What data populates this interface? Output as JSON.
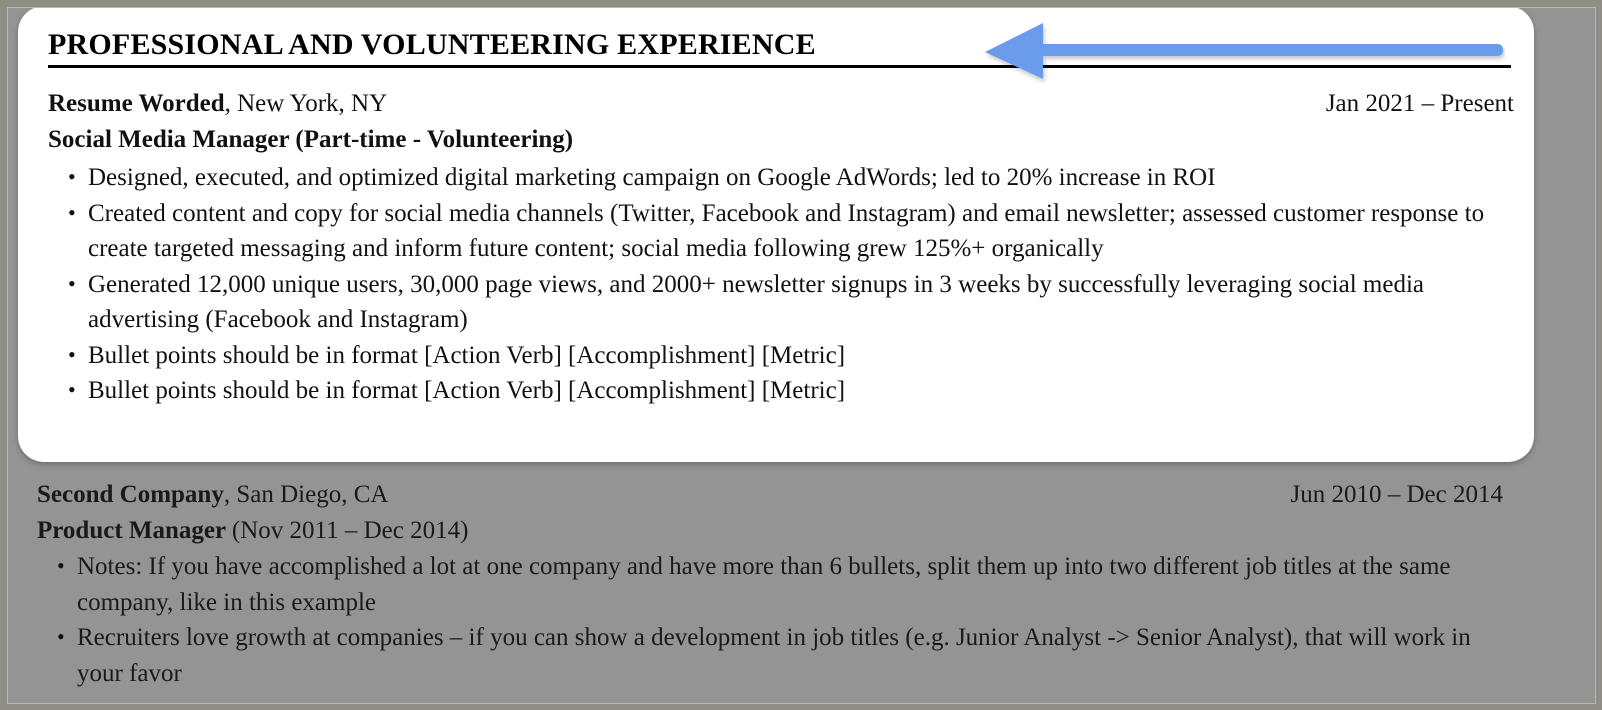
{
  "document": {
    "section_heading": "PROFESSIONAL AND VOLUNTEERING EXPERIENCE",
    "annotation": {
      "icon": "left-arrow-annotation",
      "color": "#6b9ceb",
      "direction": "left",
      "points_at": "section-heading"
    },
    "entries": [
      {
        "company": "Resume Worded",
        "separator": ", ",
        "location": "New York, NY",
        "dates": "Jan 2021 – Present",
        "role": "Social Media Manager (Part-time - Volunteering)",
        "role_dates": "",
        "highlighted": true,
        "bullets": [
          "Designed, executed, and optimized digital marketing campaign on Google AdWords; led to 20% increase in ROI",
          "Created content and copy for social media channels (Twitter, Facebook and Instagram) and email newsletter; assessed customer response to create targeted messaging and inform future content; social media following grew 125%+ organically",
          "Generated 12,000 unique users, 30,000 page views, and 2000+ newsletter signups in 3 weeks by successfully leveraging social media advertising (Facebook and Instagram)",
          "Bullet points should be in format [Action Verb] [Accomplishment] [Metric]",
          "Bullet points should be in format [Action Verb] [Accomplishment] [Metric]"
        ]
      },
      {
        "company": "Second Company",
        "separator": ", ",
        "location": "San Diego, CA",
        "dates": "Jun 2010 – Dec 2014",
        "role": "Product Manager ",
        "role_dates": "(Nov 2011 – Dec 2014)",
        "highlighted": false,
        "bullets": [
          "Notes: If you have accomplished a lot at one company and have more than 6 bullets, split them up into two different job titles at the same company, like in this example",
          "Recruiters love growth at companies – if you can show a development in job titles (e.g. Junior Analyst -> Senior Analyst), that will work in your favor"
        ]
      }
    ]
  },
  "colors": {
    "page_background": "#949494",
    "card_background": "#ffffff",
    "frame_border": "#8e8e84",
    "text": "#111111",
    "arrow": "#6b9ceb"
  }
}
